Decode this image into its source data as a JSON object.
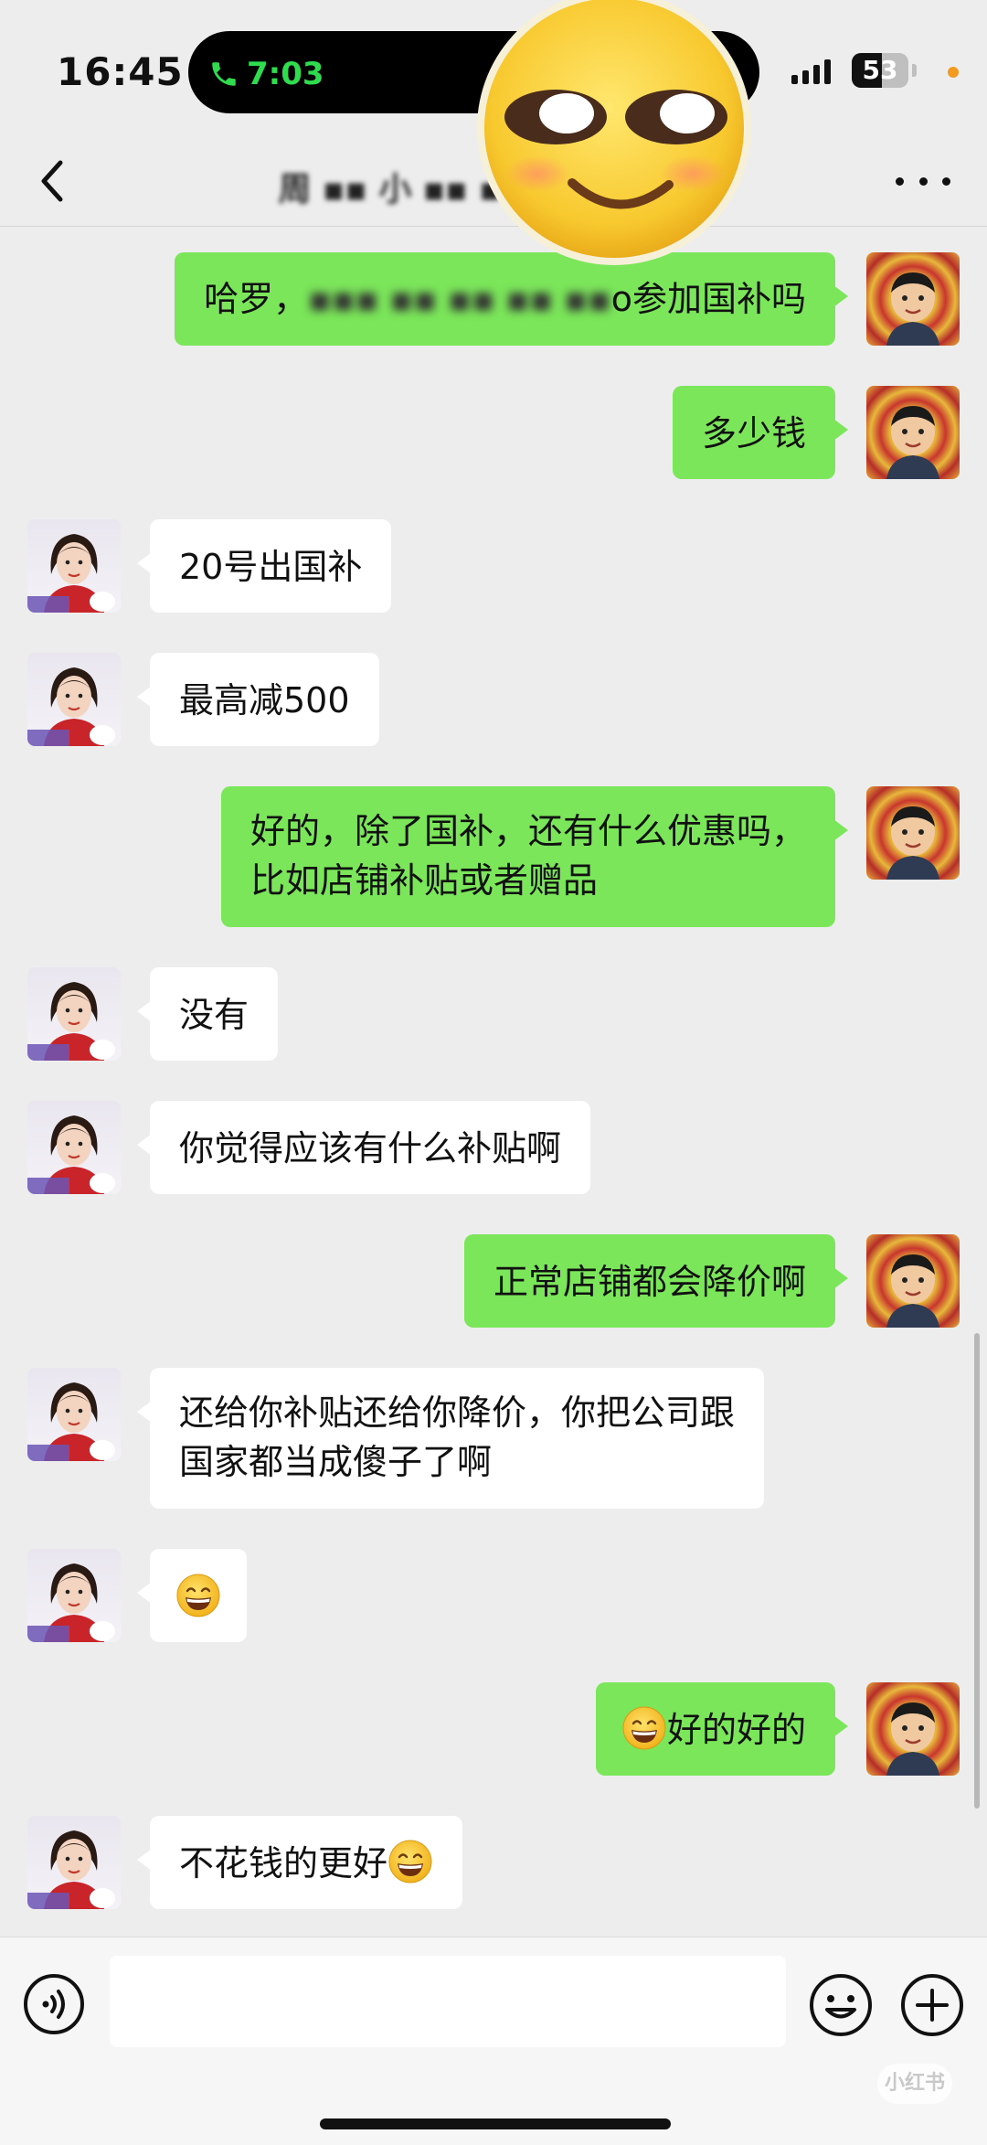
{
  "status_bar": {
    "time": "16:45",
    "call_duration": "7:03",
    "battery": "53",
    "battery_level_percent": 53,
    "accent_green": "#2fdc4d"
  },
  "nav": {
    "title": "周 ▪▪ 小 ▪▪ ▪ ▪",
    "back_icon": "chevron-left-icon",
    "more_icon": "more-dots-icon"
  },
  "colors": {
    "outgoing_bubble": "#7be65a",
    "incoming_bubble": "#ffffff",
    "background": "#ededed"
  },
  "messages": [
    {
      "side": "out",
      "prefix": "哈罗，",
      "blurred": "▪▪▪ ▪▪ ▪▪ ▪▪ ▪▪",
      "suffix": "o参加国补吗"
    },
    {
      "side": "out",
      "text": "多少钱"
    },
    {
      "side": "in",
      "text": "20号出国补"
    },
    {
      "side": "in",
      "text": "最高减500"
    },
    {
      "side": "out",
      "line1": "好的，除了国补，还有什么优惠吗，",
      "line2": "比如店铺补贴或者赠品"
    },
    {
      "side": "in",
      "text": "没有"
    },
    {
      "side": "in",
      "text": "你觉得应该有什么补贴啊"
    },
    {
      "side": "out",
      "text": "正常店铺都会降价啊"
    },
    {
      "side": "in",
      "line1": "还给你补贴还给你降价，你把公司跟",
      "line2": "国家都当成傻子了啊"
    },
    {
      "side": "in",
      "emoji": "grin-emoji"
    },
    {
      "side": "out",
      "text": "好的好的",
      "emoji": "grin-emoji"
    },
    {
      "side": "in",
      "text": "不花钱的更好",
      "emoji": "grin-emoji"
    }
  ],
  "input_bar": {
    "placeholder": "",
    "voice_icon": "voice-icon",
    "emoji_icon": "smiley-icon",
    "plus_icon": "plus-icon"
  },
  "watermark": "小红书"
}
